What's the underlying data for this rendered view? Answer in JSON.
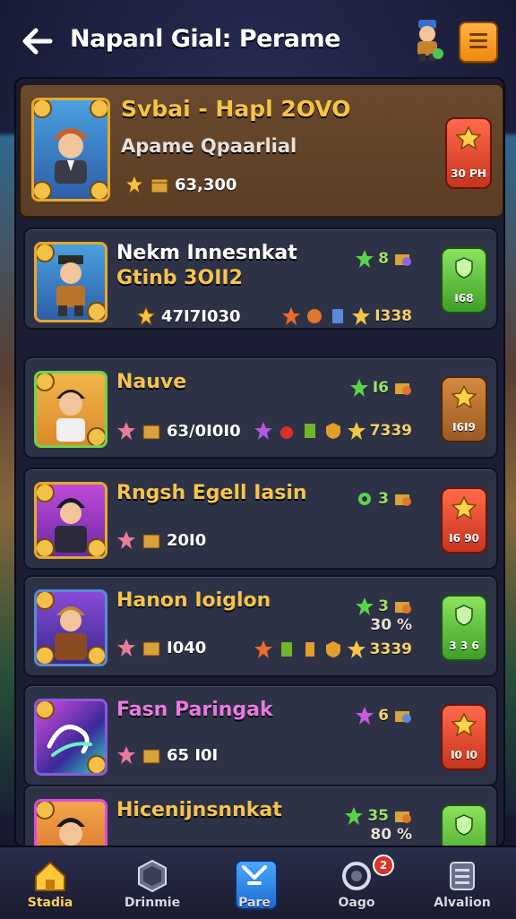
{
  "header": {
    "title": "Napanl Gial: Perame"
  },
  "rows": [
    {
      "name": "Svbai - Hapl 2OVO",
      "subtitle": "Apame Qpaarlial",
      "stat": "63,300",
      "action_label": "30 PH",
      "action_color": "#d9442a",
      "highlight": true
    },
    {
      "name_line1": "Nekm Innesnkat",
      "name_line2": "Gtinb 3OII2",
      "stat": "47I7I030",
      "reward_value": "8",
      "extra_value": "I338",
      "action_label": "I68",
      "action_color": "#4fb535"
    },
    {
      "name": "Nauve",
      "stat": "63/0I0I0",
      "reward_value": "I6",
      "extra_value": "7339",
      "action_label": "I6I9",
      "action_color": "#b06a2a"
    },
    {
      "name": "Rngsh Egell Iasin",
      "stat": "20I0",
      "reward_value": "3",
      "action_label": "I6 90",
      "action_color": "#d9442a"
    },
    {
      "name": "Hanon Ioiglon",
      "stat": "I040",
      "reward_value": "3",
      "reward_note": "30 %",
      "extra_value": "3339",
      "action_label": "3 3 6",
      "action_color": "#4fb535"
    },
    {
      "name": "Fasn Paringak",
      "stat": "65 I0I",
      "reward_value": "6",
      "action_label": "I0 I0",
      "action_color": "#d9442a"
    },
    {
      "name": "Hicenijnsnnkat",
      "reward_value": "35",
      "reward_note": "80 %",
      "action_color": "#4fb535"
    }
  ],
  "nav": [
    {
      "label": "Stadia",
      "icon": "home-icon",
      "active": true
    },
    {
      "label": "Drinmie",
      "icon": "hexagon-icon"
    },
    {
      "label": "Pare",
      "icon": "battle-icon"
    },
    {
      "label": "Oago",
      "icon": "ring-icon",
      "badge": "2"
    },
    {
      "label": "Alvalion",
      "icon": "list-icon"
    }
  ],
  "colors": {
    "gold": "#f4c54a",
    "card": "#2e3247",
    "highlight_card": "#6b4a2e"
  }
}
